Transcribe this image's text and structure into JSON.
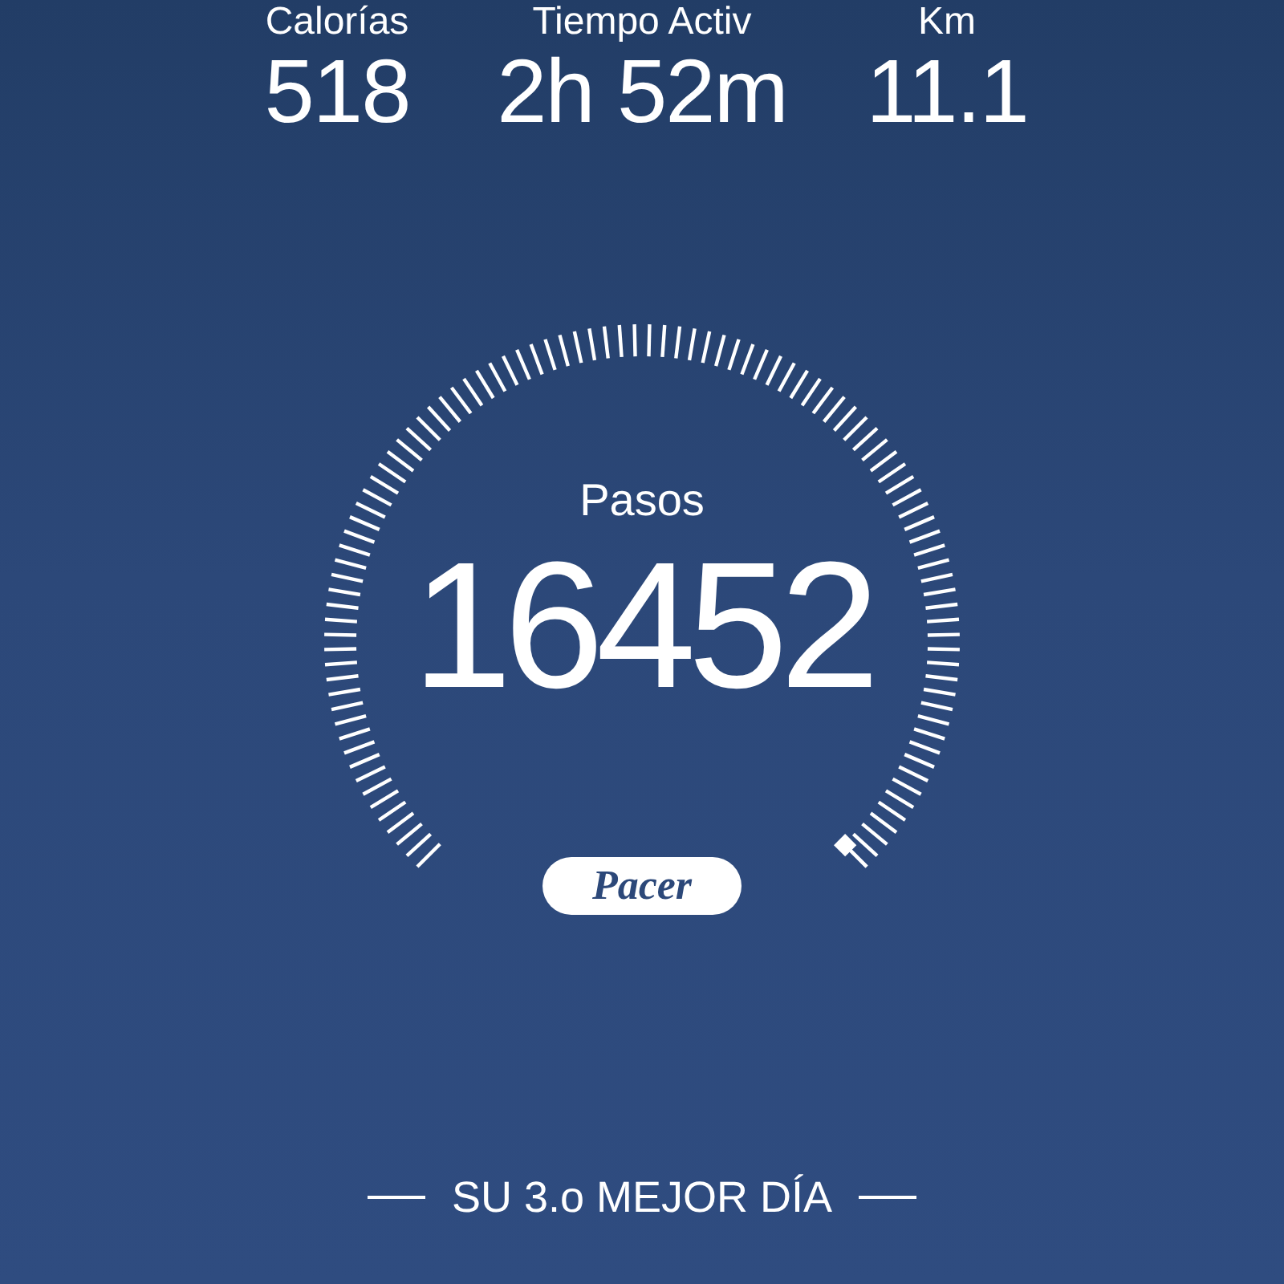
{
  "stats": [
    {
      "label": "Calorías",
      "value": "518"
    },
    {
      "label": "Tiempo Activ",
      "value": "2h 52m"
    },
    {
      "label": "Km",
      "value": "11.1"
    }
  ],
  "gauge": {
    "label": "Pasos",
    "value": "16452"
  },
  "brand": "Pacer",
  "rank_text": "SU 3.o MEJOR DÍA"
}
